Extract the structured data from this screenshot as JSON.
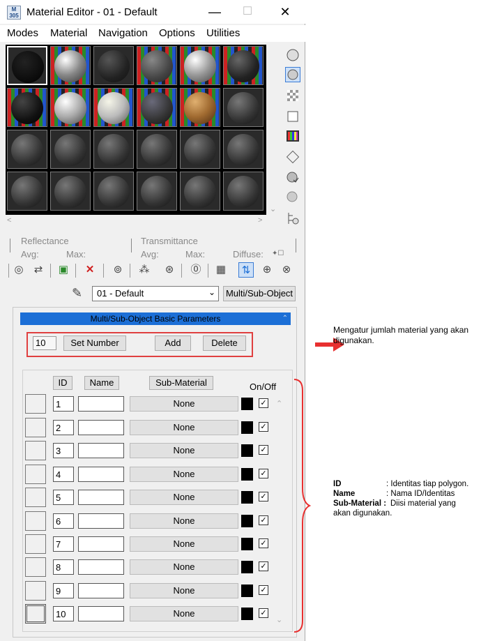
{
  "window": {
    "app_icon_text": "M 305",
    "title": "Material Editor - 01 - Default",
    "minimize": "—",
    "maximize": "☐",
    "close": "✕"
  },
  "menu": [
    "Modes",
    "Material",
    "Navigation",
    "Options",
    "Utilities"
  ],
  "params": {
    "reflectance": "Reflectance",
    "transmittance": "Transmittance",
    "avg": "Avg:",
    "max": "Max:",
    "diffuse": "Diffuse:"
  },
  "material_name": "01 - Default",
  "material_type": "Multi/Sub-Object",
  "rollout_title": "Multi/Sub-Object Basic Parameters",
  "count": {
    "value": "10",
    "set_number": "Set Number",
    "add": "Add",
    "delete": "Delete"
  },
  "table": {
    "headers": {
      "id": "ID",
      "name": "Name",
      "sub_material": "Sub-Material",
      "on_off": "On/Off"
    },
    "rows": [
      {
        "id": "1",
        "sub": "None"
      },
      {
        "id": "2",
        "sub": "None"
      },
      {
        "id": "3",
        "sub": "None"
      },
      {
        "id": "4",
        "sub": "None"
      },
      {
        "id": "5",
        "sub": "None"
      },
      {
        "id": "6",
        "sub": "None"
      },
      {
        "id": "7",
        "sub": "None"
      },
      {
        "id": "8",
        "sub": "None"
      },
      {
        "id": "9",
        "sub": "None"
      },
      {
        "id": "10",
        "sub": "None"
      }
    ]
  },
  "annotations": {
    "count_note_1": "Mengatur jumlah material yang akan",
    "count_note_2": "digunakan.",
    "legend": [
      {
        "key": "ID",
        "value": ": Identitas tiap polygon."
      },
      {
        "key": "Name",
        "value": ": Nama ID/Identitas"
      },
      {
        "key": "Sub-Material :",
        "value": "Diisi material yang"
      },
      {
        "key": "",
        "value": "akan digunakan."
      }
    ]
  },
  "colors": {
    "accent": "#1c6fd6",
    "highlight": "#e04040"
  }
}
